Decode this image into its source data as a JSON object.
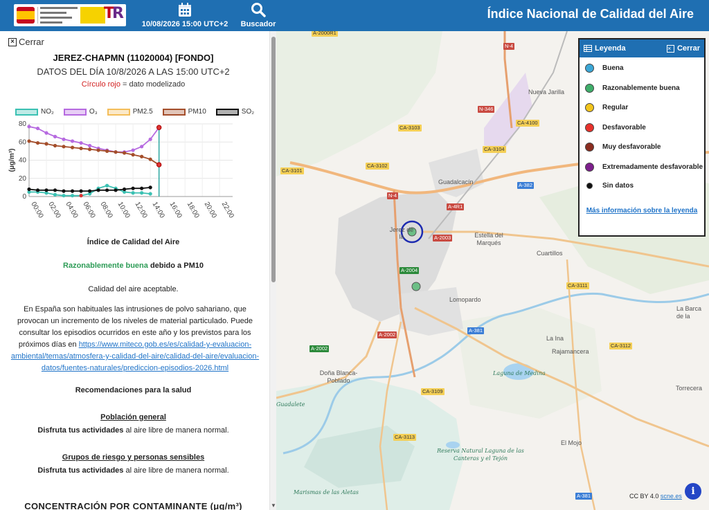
{
  "header": {
    "date_label": "10/08/2026 15:00 UTC+2",
    "search_label": "Buscador",
    "title": "Índice Nacional de Calidad del Aire",
    "accent": "#1f6fb2"
  },
  "panel": {
    "close_label": "Cerrar",
    "station": "JEREZ-CHAPMN (11020004) [FONDO]",
    "day_line": "DATOS DEL DÍA 10/8/2026 A LAS 15:00 UTC+2",
    "modeled_red": "Círculo rojo",
    "modeled_rest": " = dato modelizado",
    "index_heading": "Índice de Calidad del Aire",
    "index_value": "Razonablemente buena",
    "index_suffix": " debido a PM10",
    "quality_text": "Calidad del aire aceptable.",
    "para_text": "En España son habituales las intrusiones de polvo sahariano, que provocan un incremento de los niveles de material particulado. Puede consultar los episodios ocurridos en este año y los previstos para los próximos días en ",
    "para_link": "https://www.miteco.gob.es/es/calidad-y-evaluacion-ambiental/temas/atmosfera-y-calidad-del-aire/calidad-del-aire/evaluacion-datos/fuentes-naturales/prediccion-episodios-2026.html",
    "reco_heading": "Recomendaciones para la salud",
    "pop_general": "Población general",
    "pop_general_bold": "Disfruta tus actividades",
    "pop_general_rest": " al aire libre de manera normal.",
    "risk_groups": "Grupos de riesgo y personas sensibles",
    "risk_bold": "Disfruta tus actividades",
    "risk_rest": " al aire libre de manera normal.",
    "concentration_heading": "CONCENTRACIÓN POR CONTAMINANTE (μg/m³)"
  },
  "chart_data": {
    "type": "line",
    "ylabel": "(μg/m³)",
    "ylim": [
      0,
      80
    ],
    "yticks": [
      "0",
      "20",
      "40",
      "60",
      "80"
    ],
    "x": [
      "00:00",
      "01:00",
      "02:00",
      "03:00",
      "04:00",
      "05:00",
      "06:00",
      "07:00",
      "08:00",
      "09:00",
      "10:00",
      "11:00",
      "12:00",
      "13:00",
      "14:00",
      "15:00"
    ],
    "xticks": [
      "00:00",
      "02:00",
      "04:00",
      "06:00",
      "08:00",
      "10:00",
      "12:00",
      "14:00",
      "16:00",
      "18:00",
      "20:00",
      "22:00"
    ],
    "current_hour_index": 15,
    "series": [
      {
        "name": "NO₂",
        "color": "#3bc1b3",
        "values": [
          5,
          5,
          4,
          2,
          1,
          1,
          1,
          3,
          9,
          12,
          9,
          5,
          4,
          4,
          3,
          null
        ]
      },
      {
        "name": "O₃",
        "color": "#b66ae0",
        "values": [
          77,
          75,
          70,
          66,
          63,
          61,
          59,
          56,
          53,
          51,
          49,
          49,
          51,
          55,
          63,
          76
        ]
      },
      {
        "name": "PM2.5",
        "color": "#f4be5a",
        "values": [
          null,
          null,
          null,
          null,
          null,
          null,
          null,
          null,
          null,
          null,
          null,
          null,
          null,
          null,
          null,
          null
        ]
      },
      {
        "name": "PM10",
        "color": "#a44e2b",
        "values": [
          61,
          59,
          58,
          56,
          55,
          54,
          53,
          52,
          51,
          50,
          49,
          48,
          46,
          44,
          41,
          35
        ]
      },
      {
        "name": "SO₂",
        "color": "#111111",
        "values": [
          8,
          7,
          7,
          7,
          6,
          6,
          6,
          6,
          7,
          7,
          7,
          8,
          9,
          9,
          10,
          null
        ]
      }
    ]
  },
  "map": {
    "places": [
      "Nueva Jarilla",
      "Guadalcacín",
      "Estella del Marqués",
      "Cuartillos",
      "Lomopardo",
      "La Ina",
      "Rajamancera",
      "La Barca de la Florida",
      "Torrecera",
      "Doña Blanca-Poblado",
      "El Mojo",
      "Jerez de la Frontera"
    ],
    "natural": [
      "Laguna de Medina",
      "Reserva Natural Laguna de las Canteras y el Tejón",
      "Marismas de las Aletas",
      "Guadalete"
    ],
    "roads": [
      "A-2000R1",
      "N-4",
      "N-346",
      "CA-4100",
      "CA-3103",
      "CA-3104",
      "CA-3101",
      "CA-3102",
      "A-382",
      "A-4R1",
      "N-4",
      "A-2003",
      "A-2004",
      "CA-3111",
      "A-381",
      "A-2002",
      "CA-3112",
      "A-2002",
      "CA-3109",
      "CA-3113",
      "A-381"
    ]
  },
  "legend": {
    "title": "Leyenda",
    "close_label": "Cerrar",
    "items": [
      {
        "label": "Buena",
        "color": "#3ba7d6"
      },
      {
        "label": "Razonablemente buena",
        "color": "#3fae6a"
      },
      {
        "label": "Regular",
        "color": "#f2c41c"
      },
      {
        "label": "Desfavorable",
        "color": "#e8322b"
      },
      {
        "label": "Muy desfavorable",
        "color": "#8b2d20"
      },
      {
        "label": "Extremadamente desfavorable",
        "color": "#7d1f8c"
      },
      {
        "label": "Sin datos",
        "color": "#111111"
      }
    ],
    "more_link": "Más información sobre la leyenda"
  },
  "attribution": {
    "prefix": "CC BY 4.0",
    "link": "scne.es"
  }
}
